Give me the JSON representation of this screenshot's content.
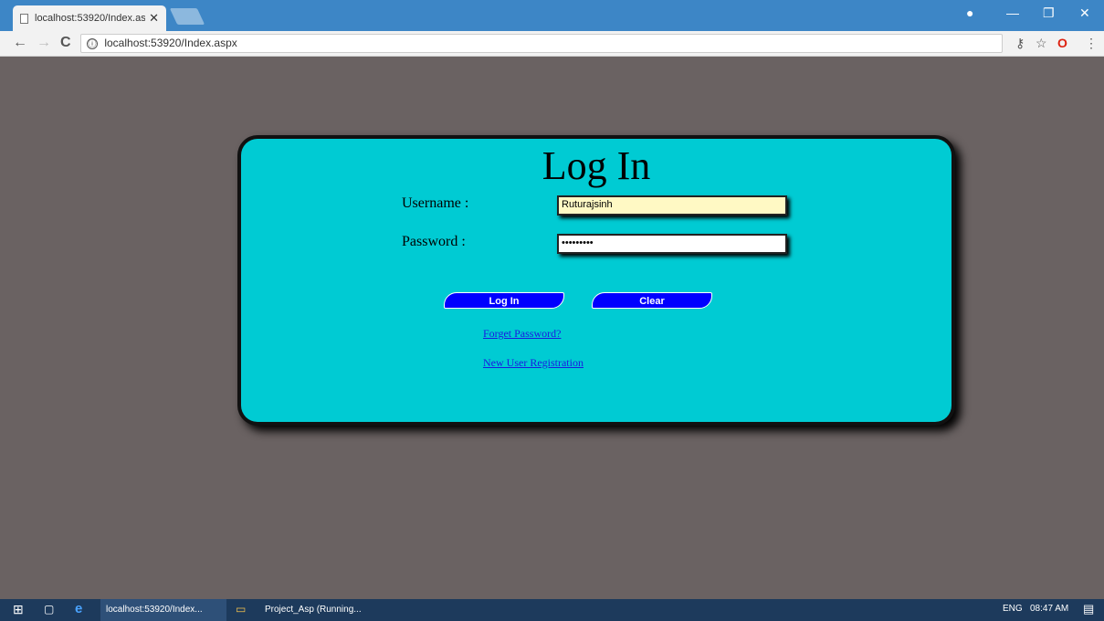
{
  "browser": {
    "tab_title": "localhost:53920/Index.as",
    "tab_close": "✕",
    "url": "localhost:53920/Index.aspx",
    "info_icon": "ⓘ",
    "back": "←",
    "forward": "→",
    "reload": "C",
    "key_icon": "⚷",
    "star_icon": "☆",
    "opera_icon": "O",
    "menu_icon": "⋮",
    "profile_icon": "●",
    "minimize": "—",
    "restore": "❐",
    "close": "✕"
  },
  "login": {
    "title": "Log In",
    "username_label": "Username :",
    "username_value": "Ruturajsinh",
    "password_label": "Password :",
    "password_value": "•••••••••",
    "login_button": "Log In",
    "clear_button": "Clear",
    "forgot_link": "Forget Password?",
    "register_link": "New User Registration"
  },
  "taskbar": {
    "start_icon": "⊞",
    "task_view_icon": "▢",
    "edge_icon": "e",
    "chrome_task": "localhost:53920/Index...",
    "explorer_icon": "▭",
    "vs_task": "Project_Asp (Running...",
    "language": "ENG",
    "time": "08:47 AM",
    "notification_icon": "▤"
  },
  "colors": {
    "panel": "#00cbd3",
    "button": "#0000ff",
    "page_bg": "#6a6262"
  }
}
